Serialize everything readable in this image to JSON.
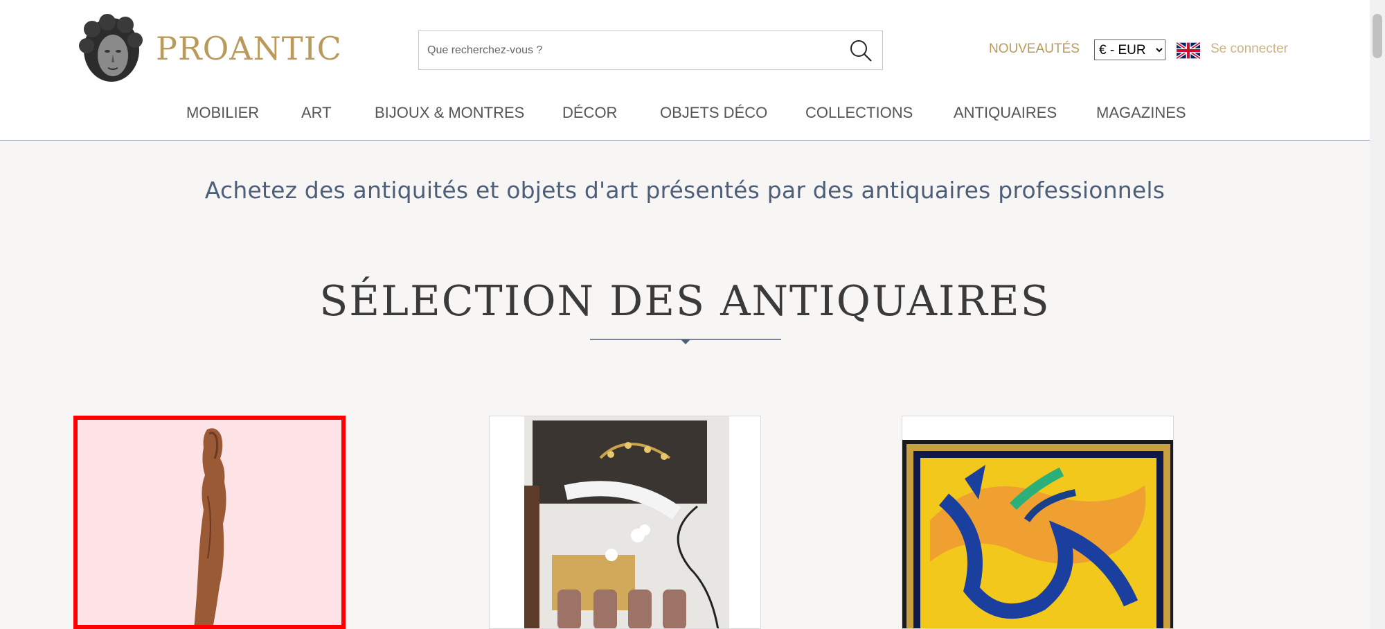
{
  "header": {
    "logo_text": "PROANTIC",
    "search_placeholder": "Que recherchez-vous ?",
    "nouveautes": "NOUVEAUTÉS",
    "currency_selected": "€ - EUR",
    "login": "Se connecter"
  },
  "nav": {
    "items": [
      "MOBILIER",
      "ART",
      "BIJOUX & MONTRES",
      "DÉCOR",
      "OBJETS DÉCO",
      "COLLECTIONS",
      "ANTIQUAIRES",
      "MAGAZINES"
    ]
  },
  "tagline": "Achetez des antiquités et objets d'art présentés par des antiquaires professionnels",
  "section_title": "SÉLECTION DES ANTIQUAIRES",
  "cards": [
    {
      "subject": "wooden-figure-sculpture",
      "selected": true
    },
    {
      "subject": "staircase-interior-with-chairs",
      "selected": false
    },
    {
      "subject": "abstract-painting-framed",
      "selected": false
    }
  ],
  "colors": {
    "brand_gold": "#b99a5b",
    "tagline_blue": "#4d5e78",
    "selection_red": "#ff0000"
  }
}
